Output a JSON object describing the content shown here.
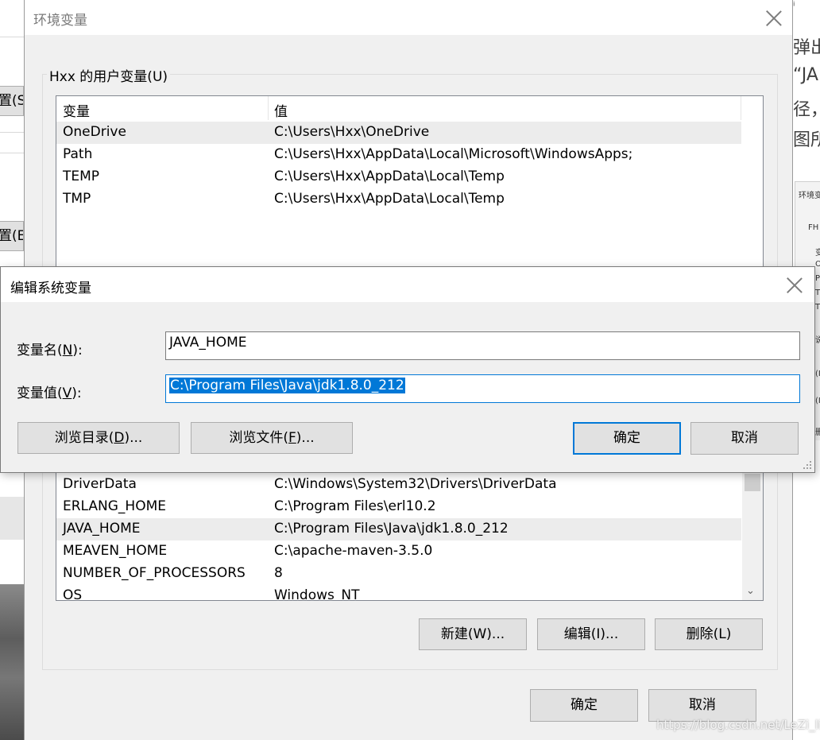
{
  "background": {
    "left_buttons": [
      "置(S)",
      "置(E)"
    ],
    "right_text": [
      "弹出",
      "“JA",
      "径，",
      "图所"
    ],
    "right_mini": [
      "环境变",
      "FH",
      "变",
      "O",
      "P",
      "T",
      "T",
      "说",
      "(I",
      "(I",
      "删"
    ]
  },
  "env_window": {
    "title": "环境变量",
    "user_group_label": "Hxx 的用户变量(U)",
    "user_vars": {
      "col_var": "变量",
      "col_value": "值",
      "rows": [
        {
          "name": "OneDrive",
          "value": "C:\\Users\\Hxx\\OneDrive"
        },
        {
          "name": "Path",
          "value": "C:\\Users\\Hxx\\AppData\\Local\\Microsoft\\WindowsApps;"
        },
        {
          "name": "TEMP",
          "value": "C:\\Users\\Hxx\\AppData\\Local\\Temp"
        },
        {
          "name": "TMP",
          "value": "C:\\Users\\Hxx\\AppData\\Local\\Temp"
        }
      ]
    },
    "system_vars": {
      "rows": [
        {
          "name": "DriverData",
          "value": "C:\\Windows\\System32\\Drivers\\DriverData"
        },
        {
          "name": "ERLANG_HOME",
          "value": "C:\\Program Files\\erl10.2"
        },
        {
          "name": "JAVA_HOME",
          "value": "C:\\Program Files\\Java\\jdk1.8.0_212"
        },
        {
          "name": "MEAVEN_HOME",
          "value": "C:\\apache-maven-3.5.0"
        },
        {
          "name": "NUMBER_OF_PROCESSORS",
          "value": "8"
        },
        {
          "name": "OS",
          "value": "Windows_NT"
        }
      ]
    },
    "buttons": {
      "new": "新建(W)...",
      "edit": "编辑(I)...",
      "delete": "删除(L)",
      "ok": "确定",
      "cancel": "取消"
    }
  },
  "edit_dialog": {
    "title": "编辑系统变量",
    "name_label_pre": "变量名(",
    "name_label_key": "N",
    "name_label_post": "):",
    "name_value": "JAVA_HOME",
    "value_label_pre": "变量值(",
    "value_label_key": "V",
    "value_label_post": "):",
    "value_value": "C:\\Program Files\\Java\\jdk1.8.0_212",
    "buttons": {
      "browse_dir_pre": "浏览目录(",
      "browse_dir_key": "D",
      "browse_dir_post": ")...",
      "browse_file_pre": "浏览文件(",
      "browse_file_key": "F",
      "browse_file_post": ")...",
      "ok": "确定",
      "cancel": "取消"
    }
  },
  "watermark": "https://blog.csdn.net/LeZi_lie",
  "colors": {
    "accent": "#0078d7",
    "dialog_bg": "#f0f0f0",
    "button_bg": "#e1e1e1"
  }
}
